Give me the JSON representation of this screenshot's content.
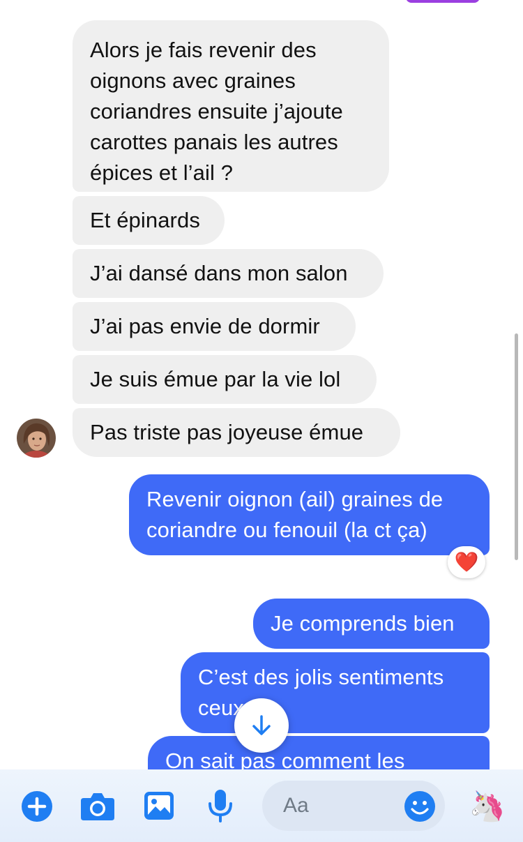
{
  "conversation": {
    "incoming": [
      "Alors je fais revenir des oignons avec graines coriandres ensuite j’ajoute carottes panais les autres épices et l’ail ?",
      "Et épinards",
      "J’ai dansé dans mon salon",
      "J’ai pas envie de dormir",
      "Je suis émue par la vie lol",
      "Pas triste pas joyeuse émue"
    ],
    "outgoing": [
      "Revenir oignon (ail) graines de coriandre ou fenouil (la ct ça)",
      "Je comprends bien",
      "C’est des jolis sentiments ceux",
      "On sait pas comment les"
    ],
    "reaction": "❤️"
  },
  "composer": {
    "placeholder": "Aa",
    "icons": [
      "plus-icon",
      "camera-icon",
      "gallery-icon",
      "microphone-icon",
      "emoji-icon",
      "unicorn-emoji"
    ],
    "unicorn": "🦄"
  },
  "colors": {
    "incoming_bubble": "#efefef",
    "outgoing_bubble": "#3f6af7",
    "accent": "#1f7ef2"
  }
}
